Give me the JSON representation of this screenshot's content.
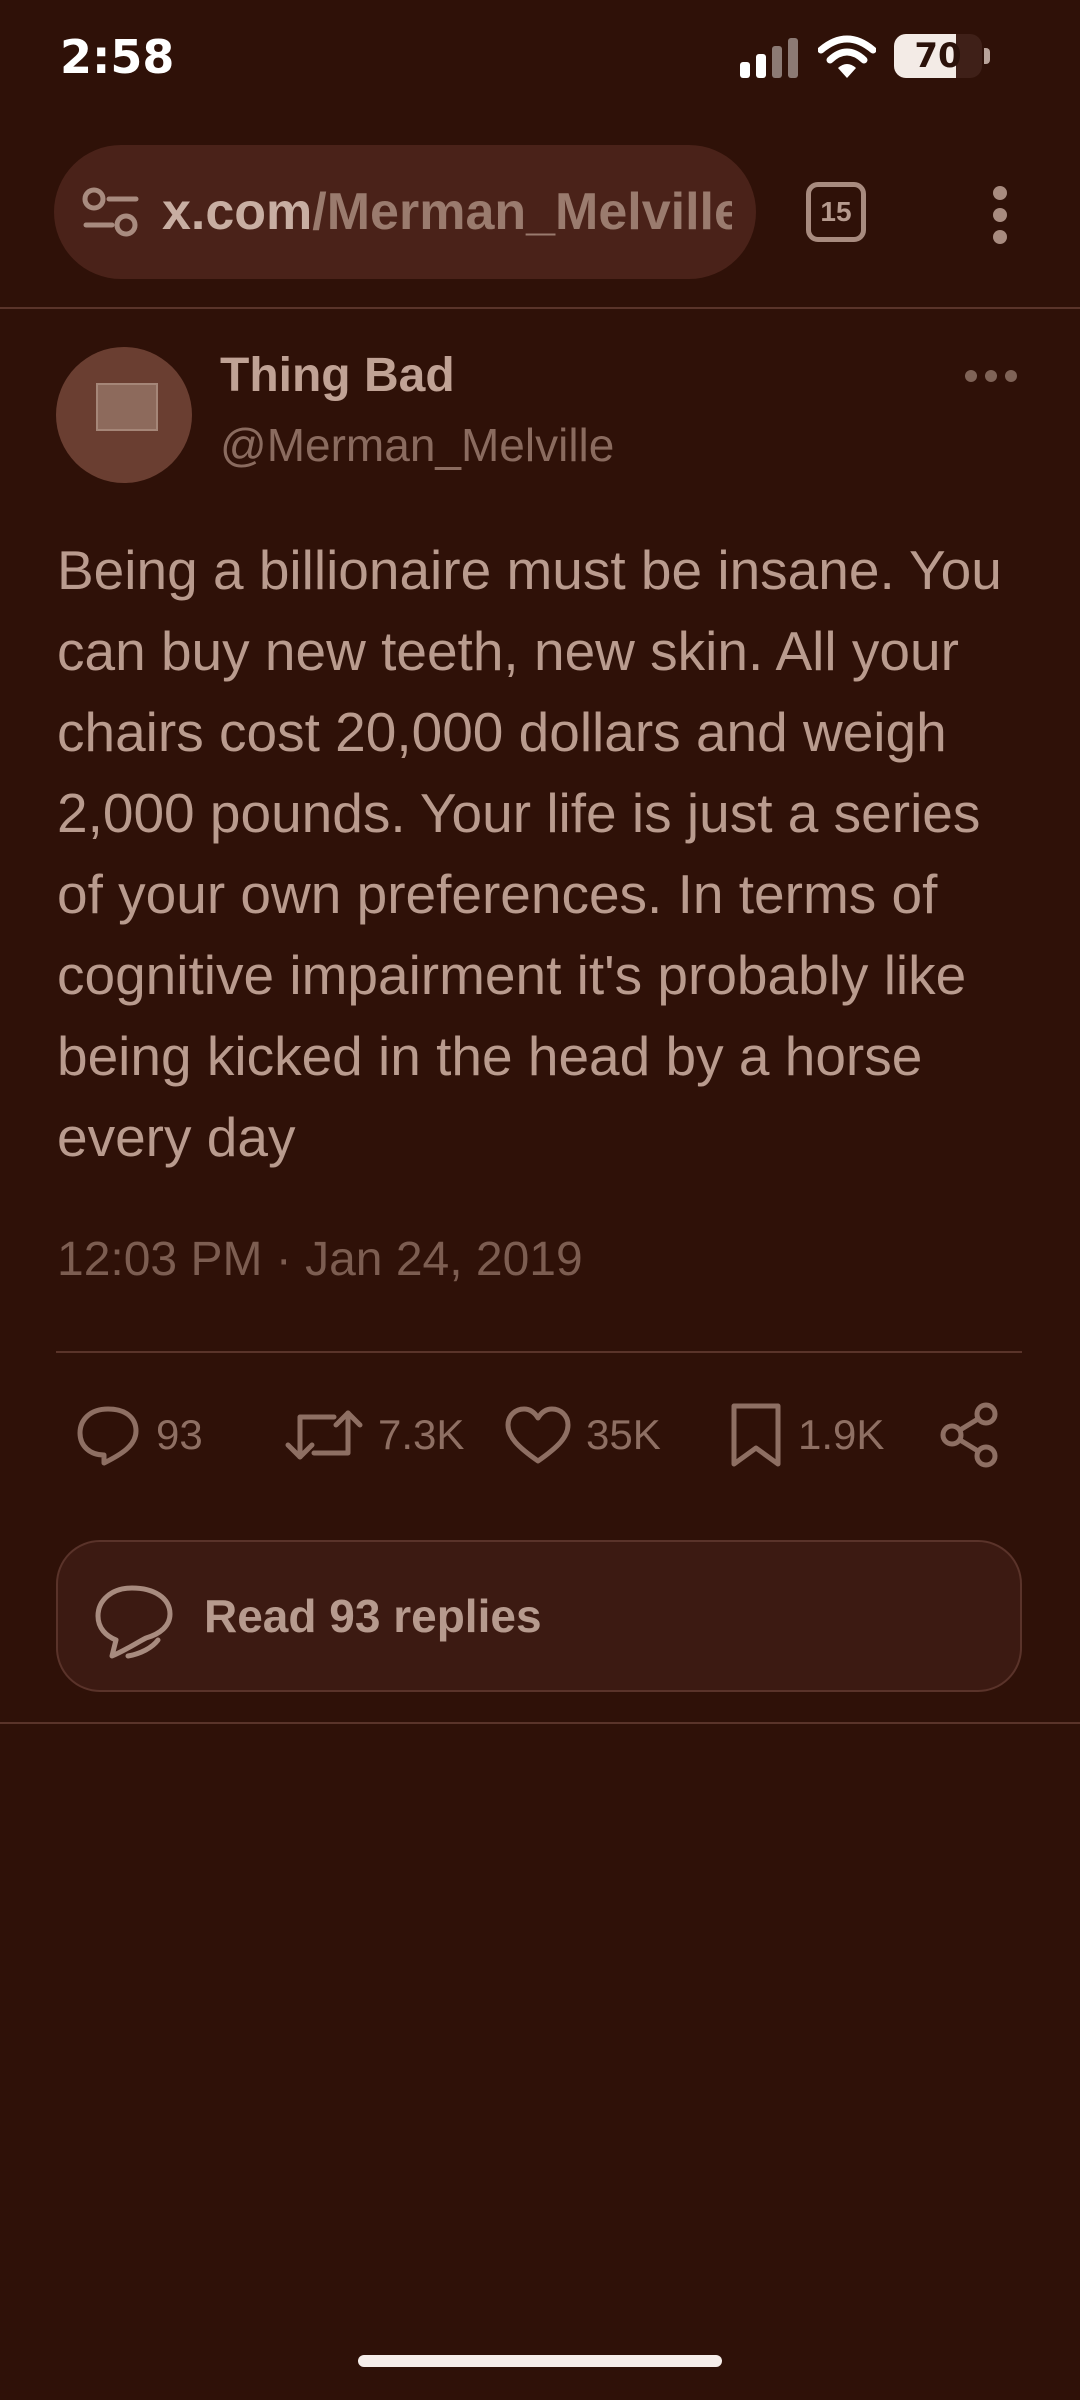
{
  "status_bar": {
    "time": "2:58",
    "battery_level": 70,
    "battery_text": "70"
  },
  "browser": {
    "url_domain": "x.com",
    "url_path": "/Merman_Melville",
    "tabs_count": "15",
    "icons": [
      "tune-icon",
      "more-vertical-icon"
    ]
  },
  "tweet": {
    "author_name": "Thing Bad",
    "author_handle": "@Merman_Melville",
    "text": "Being a billionaire must be insane. You can buy new teeth, new skin. All your chairs cost 20,000 dollars and weigh 2,000 pounds. Your life is just a series of your own preferences. In terms of cognitive impairment it's probably like being kicked in the head by a horse every day",
    "timestamp": "12:03 PM · Jan 24, 2019"
  },
  "actions": {
    "replies": "93",
    "reposts": "7.3K",
    "likes": "35K",
    "bookmarks": "1.9K"
  },
  "read_replies_label": "Read 93 replies",
  "colors": {
    "background": "#2f1108",
    "text_primary": "#b99b8e",
    "text_secondary": "#8a6b5f",
    "url_bar": "#4a2219"
  }
}
